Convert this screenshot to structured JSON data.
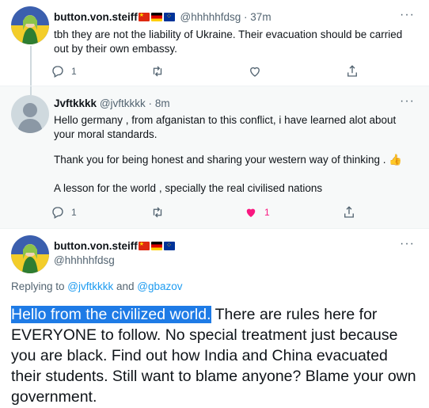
{
  "tweets": [
    {
      "name": "button.von.steiff",
      "flags": [
        "cn",
        "de",
        "eu"
      ],
      "handle": "@hhhhhfdsg",
      "separator": "·",
      "time": "37m",
      "text": "tbh they are not the liability of Ukraine. Their evacuation should be carried out by their own embassy.",
      "reply_count": "1"
    },
    {
      "name": "Jvftkkkk",
      "handle": "@jvftkkkk",
      "separator": "·",
      "time": "8m",
      "paragraphs": [
        "Hello germany , from afganistan to this conflict,  i have learned alot about your moral standards.",
        "Thank you for being honest and sharing your western way of thinking . 👍",
        "A lesson for the world , specially the real civilised nations"
      ],
      "reply_count": "1",
      "like_count": "1"
    },
    {
      "name": "button.von.steiff",
      "flags": [
        "cn",
        "de",
        "eu"
      ],
      "handle": "@hhhhhfdsg",
      "replying_prefix": "Replying to ",
      "mention_1": "@jvftkkkk",
      "replying_and": " and ",
      "mention_2": "@gbazov",
      "highlighted_text": "Hello from the civilized world.",
      "text": " There are rules here for EVERYONE to follow. No special treatment just because you are black. Find out how India and China evacuated their students. Still want to blame anyone? Blame your own government."
    }
  ],
  "more_label": "···",
  "icons": [
    "reply-icon",
    "retweet-icon",
    "like-icon",
    "share-icon",
    "more-icon"
  ],
  "colors": {
    "accent": "#1d9bf0",
    "like": "#f91880",
    "muted": "#536471",
    "highlight": "#1e7be6"
  }
}
